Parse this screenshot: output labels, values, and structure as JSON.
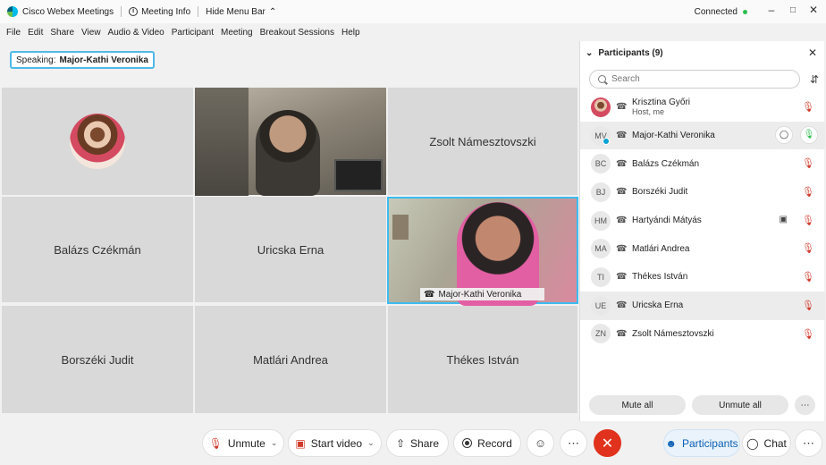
{
  "titlebar": {
    "app_title": "Cisco Webex Meetings",
    "meeting_info": "Meeting Info",
    "hide_menu_bar": "Hide Menu Bar",
    "status": "Connected",
    "status_color": "#2dbd4e"
  },
  "menu": [
    "File",
    "Edit",
    "Share",
    "View",
    "Audio & Video",
    "Participant",
    "Meeting",
    "Breakout Sessions",
    "Help"
  ],
  "speaking": {
    "label": "Speaking:",
    "name": "Major-Kathi Veronika"
  },
  "grid": {
    "cells": [
      "Zsolt Námesztovszki",
      "Balázs Czékmán",
      "Uricska Erna",
      "Borszéki Judit",
      "Matlári Andrea",
      "Thékes István"
    ],
    "active_video_name": "Major-Kathi Veronika"
  },
  "controls": {
    "unmute": "Unmute",
    "start_video": "Start video",
    "share": "Share",
    "record": "Record",
    "participants": "Participants",
    "chat": "Chat",
    "end_color": "#e0321c"
  },
  "panel": {
    "title": "Participants (9)",
    "search_placeholder": "Search",
    "mute_all": "Mute all",
    "unmute_all": "Unmute all",
    "participants": [
      {
        "initials": "",
        "name": "Krisztina Győri",
        "sub": "Host, me"
      },
      {
        "initials": "MV",
        "name": "Major-Kathi Veronika"
      },
      {
        "initials": "BC",
        "name": "Balázs Czékmán"
      },
      {
        "initials": "BJ",
        "name": "Borszéki Judit"
      },
      {
        "initials": "HM",
        "name": "Hartyándi Mátyás"
      },
      {
        "initials": "MA",
        "name": "Matlári Andrea"
      },
      {
        "initials": "TI",
        "name": "Thékes István"
      },
      {
        "initials": "UE",
        "name": "Uricska Erna"
      },
      {
        "initials": "ZN",
        "name": "Zsolt Námesztovszki"
      }
    ]
  }
}
